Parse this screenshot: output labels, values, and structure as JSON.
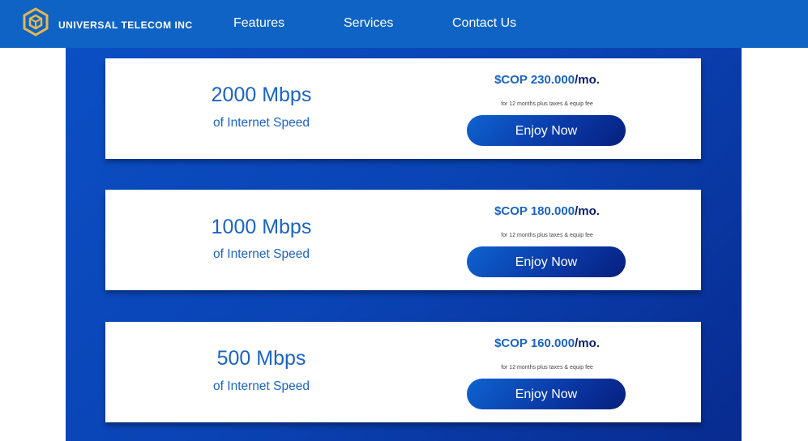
{
  "header": {
    "brand": "UNIVERSAL TELECOM INC",
    "logo_icon": "hexagon-cube-logo",
    "nav": [
      {
        "label": "Features"
      },
      {
        "label": "Services"
      },
      {
        "label": "Contact Us"
      }
    ]
  },
  "colors": {
    "header_bg": "#0f63c4",
    "panel_bg": "#0a43b4",
    "accent_blue": "#1b64c3",
    "logo_gold": "#e6b84b"
  },
  "plans": [
    {
      "speed": "2000 Mbps",
      "speed_sub": "of Internet Speed",
      "price_amount": "$COP 230.000",
      "price_suffix": "/mo.",
      "fine_print": "for 12 months plus taxes & equip fee",
      "cta": "Enjoy Now"
    },
    {
      "speed": "1000 Mbps",
      "speed_sub": "of Internet Speed",
      "price_amount": "$COP 180.000",
      "price_suffix": "/mo.",
      "fine_print": "for 12 months plus taxes & equip fee",
      "cta": "Enjoy Now"
    },
    {
      "speed": "500 Mbps",
      "speed_sub": "of Internet Speed",
      "price_amount": "$COP 160.000",
      "price_suffix": "/mo.",
      "fine_print": "for 12 months plus taxes & equip fee",
      "cta": "Enjoy Now"
    }
  ]
}
